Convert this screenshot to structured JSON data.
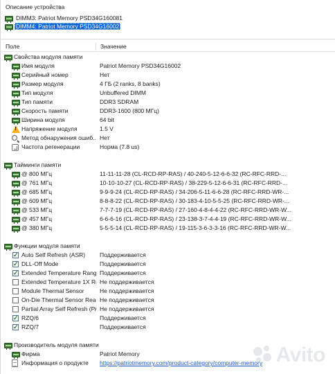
{
  "description": {
    "title": "Описание устройства",
    "devices": [
      {
        "label": "DIMM3: Patriot Memory PSD34G160081",
        "selected": false
      },
      {
        "label": "DIMM4: Patriot Memory PSD34G16002",
        "selected": true
      }
    ]
  },
  "columns": {
    "field": "Поле",
    "value": "Значение"
  },
  "groups": {
    "module_props": {
      "title": "Свойства модуля памяти",
      "rows": [
        {
          "name": "Имя модуля",
          "value": "Patriot Memory PSD34G16002",
          "icon": "ram-icon"
        },
        {
          "name": "Серийный номер",
          "value": "Нет",
          "icon": "ram-icon"
        },
        {
          "name": "Размер модуля",
          "value": "4 ГБ (2 ranks, 8 banks)",
          "icon": "ram-icon"
        },
        {
          "name": "Тип модуля",
          "value": "Unbuffered DIMM",
          "icon": "ram-icon"
        },
        {
          "name": "Тип памяти",
          "value": "DDR3 SDRAM",
          "icon": "ram-icon"
        },
        {
          "name": "Скорость памяти",
          "value": "DDR3-1600 (800 МГц)",
          "icon": "ram-icon"
        },
        {
          "name": "Ширина модуля",
          "value": "64 bit",
          "icon": "ram-icon"
        },
        {
          "name": "Напряжение модуля",
          "value": "1.5 V",
          "icon": "warning-icon"
        },
        {
          "name": "Метод обнаружения ошиб...",
          "value": "Нет",
          "icon": "magnify-icon"
        },
        {
          "name": "Частота регенерации",
          "value": "Норма (7.8 us)",
          "icon": "refresh-icon"
        }
      ]
    },
    "timings": {
      "title": "Тайминги памяти",
      "rows": [
        {
          "name": "@ 800 МГц",
          "value": "11-11-11-28  (CL-RCD-RP-RAS) / 40-240-5-12-6-6-32  (RC-RFC-RRD-..."
        },
        {
          "name": "@ 761 МГц",
          "value": "10-10-10-27  (CL-RCD-RP-RAS) / 38-229-5-12-6-6-31  (RC-RFC-RRD-..."
        },
        {
          "name": "@ 685 МГц",
          "value": "9-9-9-24  (CL-RCD-RP-RAS) / 34-206-5-11-6-6-28  (RC-RFC-RRD-WR-..."
        },
        {
          "name": "@ 609 МГц",
          "value": "8-8-8-22  (CL-RCD-RP-RAS) / 30-183-4-10-5-5-25  (RC-RFC-RRD-WR-..."
        },
        {
          "name": "@ 533 МГц",
          "value": "7-7-7-19  (CL-RCD-RP-RAS) / 27-160-4-8-4-4-22  (RC-RFC-RRD-WR-W..."
        },
        {
          "name": "@ 457 МГц",
          "value": "6-6-6-16  (CL-RCD-RP-RAS) / 23-138-3-7-4-4-19  (RC-RFC-RRD-WR-W..."
        },
        {
          "name": "@ 380 МГц",
          "value": "5-5-5-14  (CL-RCD-RP-RAS) / 19-115-3-6-3-3-16  (RC-RFC-RRD-WR-W..."
        }
      ]
    },
    "features": {
      "title": "Функции модуля памяти",
      "rows": [
        {
          "name": "Auto Self Refresh (ASR)",
          "value": "Поддерживается",
          "checked": true
        },
        {
          "name": "DLL-Off Mode",
          "value": "Поддерживается",
          "checked": true
        },
        {
          "name": "Extended Temperature Range",
          "value": "Поддерживается",
          "checked": true
        },
        {
          "name": "Extended Temperature 1X Re...",
          "value": "Не поддерживается",
          "checked": false
        },
        {
          "name": "Module Thermal Sensor",
          "value": "Не поддерживается",
          "checked": false
        },
        {
          "name": "On-Die Thermal Sensor Read...",
          "value": "Не поддерживается",
          "checked": false
        },
        {
          "name": "Partial Array Self Refresh (PA...",
          "value": "Не поддерживается",
          "checked": false
        },
        {
          "name": "RZQ/6",
          "value": "Поддерживается",
          "checked": true
        },
        {
          "name": "RZQ/7",
          "value": "Поддерживается",
          "checked": true
        }
      ]
    },
    "manufacturer": {
      "title": "Производитель модуля памяти",
      "rows": [
        {
          "name": "Фирма",
          "value": "Patriot Memory",
          "icon": "ram-icon"
        },
        {
          "name": "Информация о продукте",
          "value": "https://patriotmemory.com/product-category/computer-memory",
          "icon": "document-icon"
        }
      ]
    }
  },
  "watermark": {
    "text": "Avito"
  },
  "colors": {
    "selection": "#0a64d8",
    "link": "#1a57c4",
    "ram_icon": "#3d7a35",
    "warning": "#f3b21c",
    "check": "#1b7a24"
  }
}
